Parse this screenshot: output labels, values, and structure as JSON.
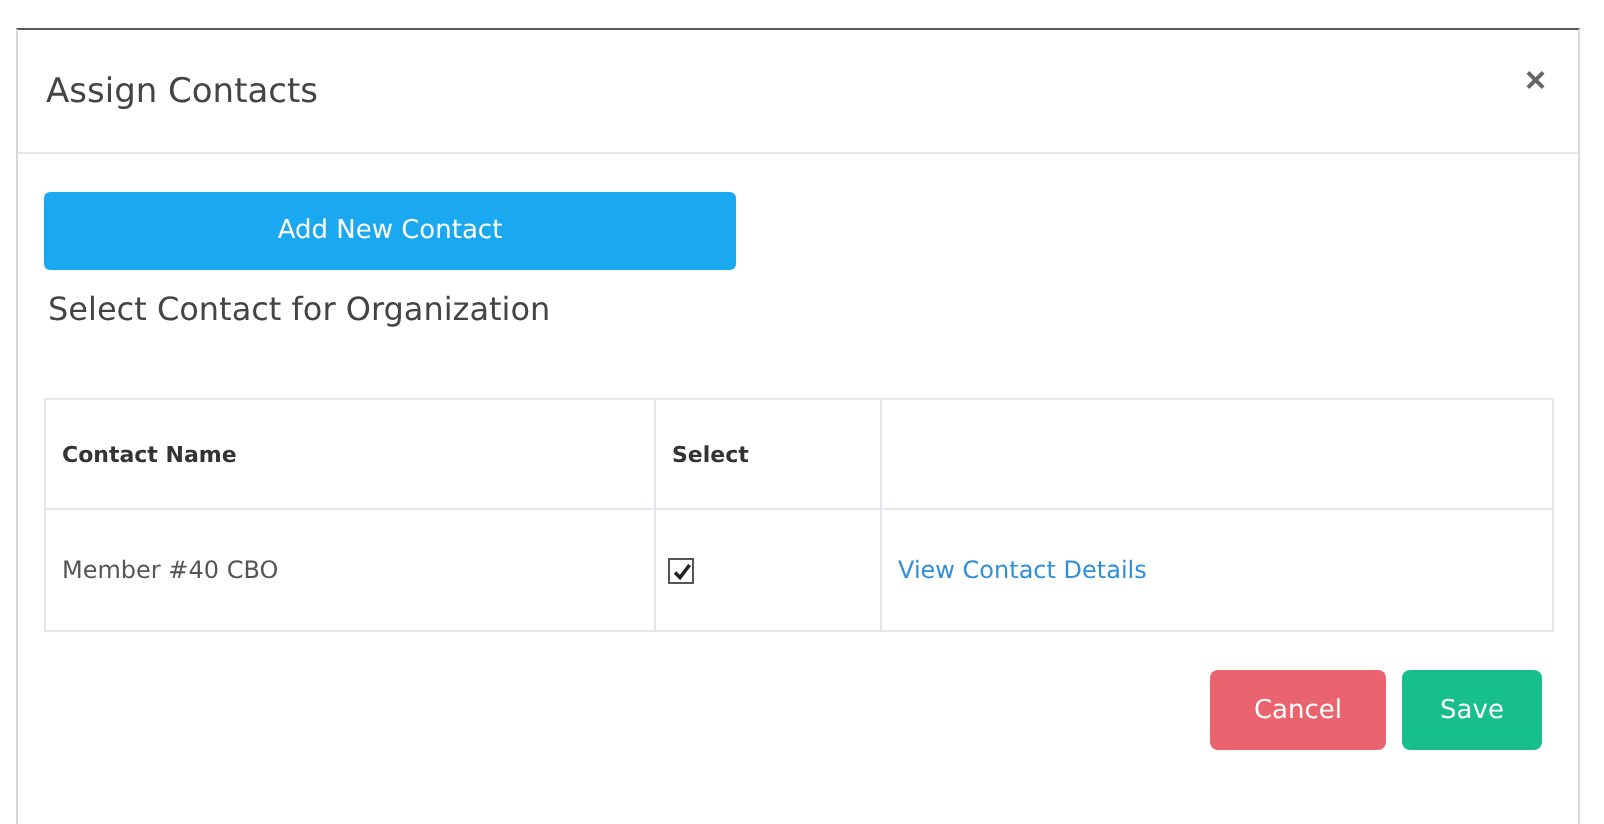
{
  "dialog": {
    "title": "Assign Contacts",
    "close": "×"
  },
  "add_button": "Add New Contact",
  "heading": "Select Contact for Organization",
  "table": {
    "columns": [
      "Contact Name",
      "Select"
    ],
    "rows": [
      {
        "name": "Member #40 CBO",
        "checked": true,
        "link": "View Contact Details"
      }
    ]
  },
  "buttons": [
    {
      "kind": "cancel",
      "label": "Cancel"
    },
    {
      "kind": "save",
      "label": "Save"
    }
  ]
}
